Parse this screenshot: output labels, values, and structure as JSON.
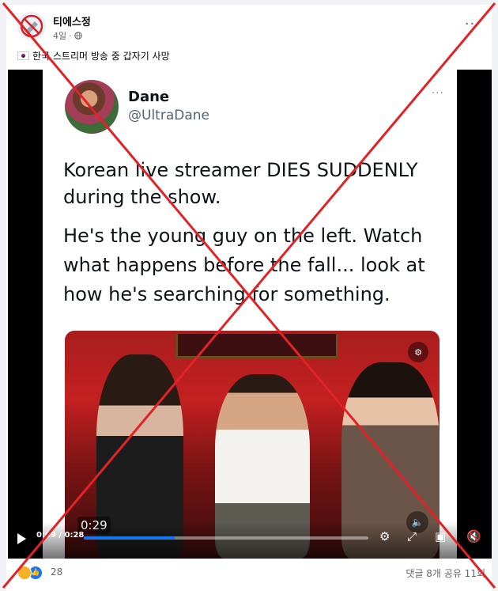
{
  "post": {
    "author": "티에스정",
    "time": "4일",
    "privacy_icon": "globe-icon",
    "caption": "한국 스트리머 방송 중 갑자기 사망",
    "caption_flag": "korea-flag-icon"
  },
  "tweet": {
    "name": "Dane",
    "handle": "@UltraDane",
    "line1": "Korean live streamer DIES SUDDENLY during the show.",
    "line2": "He's the young guy on the left.  Watch what happens before the fall... look at how he's searching for something.",
    "media_time": "0:29"
  },
  "video": {
    "time_label": "0:09 / 0:28",
    "progress": 0.32
  },
  "footer": {
    "reaction_count": "28",
    "stats": "댓글 8개  공유 11회"
  },
  "colors": {
    "x_mark": "#e32228",
    "accent": "#1877f2"
  }
}
